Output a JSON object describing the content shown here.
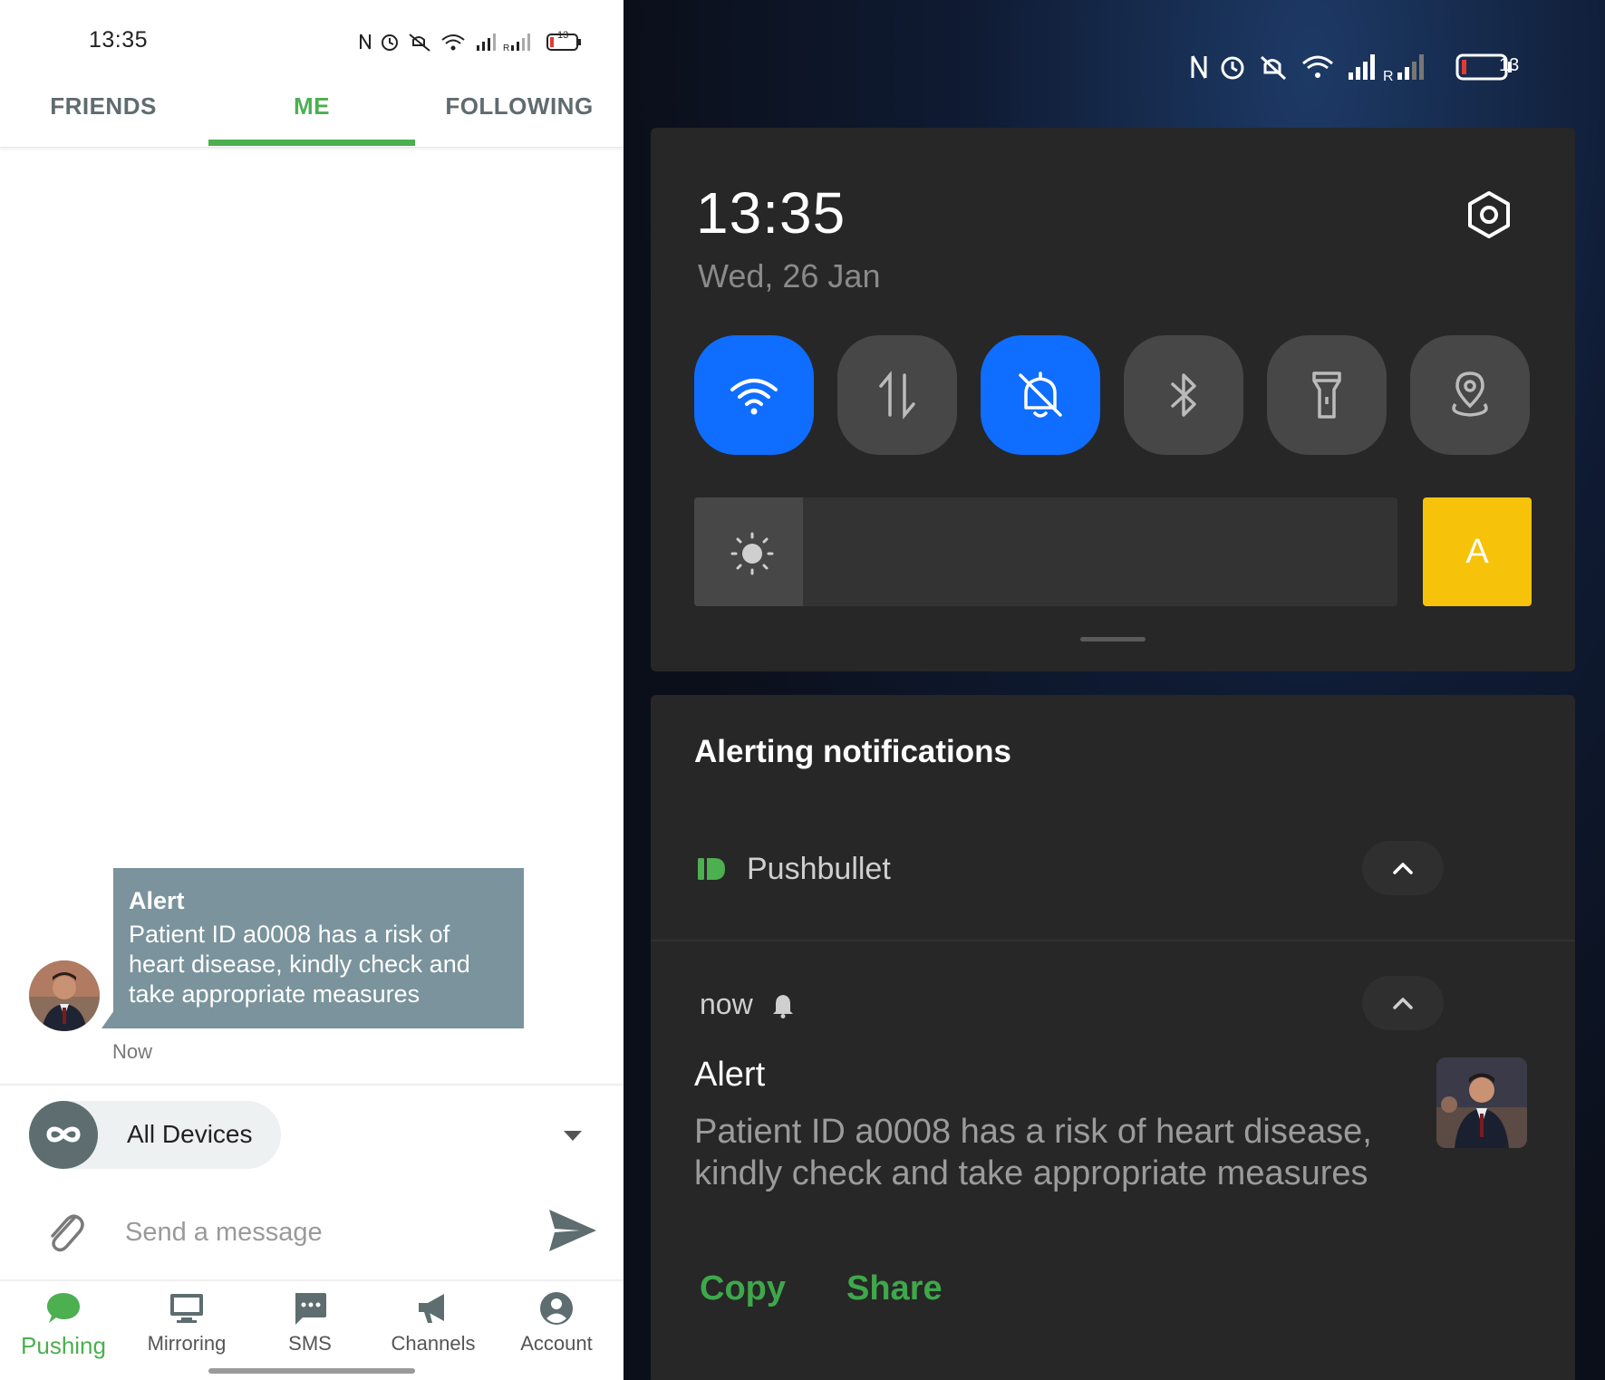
{
  "left": {
    "status_bar": {
      "time": "13:35",
      "battery": "13"
    },
    "tabs": [
      {
        "label": "FRIENDS",
        "active": false
      },
      {
        "label": "ME",
        "active": true
      },
      {
        "label": "FOLLOWING",
        "active": false
      }
    ],
    "message": {
      "title": "Alert",
      "body": "Patient ID a0008 has a risk of heart disease, kindly check and take appropriate measures",
      "time": "Now"
    },
    "device_selector": {
      "label": "All Devices"
    },
    "composer": {
      "placeholder": "Send a message"
    },
    "bottom_nav": [
      {
        "label": "Pushing",
        "icon": "chat-bubble-icon",
        "active": true
      },
      {
        "label": "Mirroring",
        "icon": "monitor-icon",
        "active": false
      },
      {
        "label": "SMS",
        "icon": "sms-icon",
        "active": false
      },
      {
        "label": "Channels",
        "icon": "megaphone-icon",
        "active": false
      },
      {
        "label": "Account",
        "icon": "account-icon",
        "active": false
      }
    ],
    "colors": {
      "accent": "#4caf50",
      "bubble": "#7a939c"
    }
  },
  "right": {
    "status_bar": {
      "battery": "13"
    },
    "quick_settings": {
      "time": "13:35",
      "date": "Wed, 26 Jan",
      "tiles": [
        {
          "name": "wifi-icon",
          "on": true
        },
        {
          "name": "mobile-data-icon",
          "on": false
        },
        {
          "name": "silent-mode-icon",
          "on": true
        },
        {
          "name": "bluetooth-icon",
          "on": false
        },
        {
          "name": "flashlight-icon",
          "on": false
        },
        {
          "name": "location-icon",
          "on": false
        }
      ],
      "brightness_level": 0.155,
      "auto_brightness_label": "A"
    },
    "notifications": {
      "header": "Alerting notifications",
      "app_name": "Pushbullet",
      "time": "now",
      "title": "Alert",
      "body": "Patient ID a0008 has a risk of heart disease, kindly check and take appropriate measures",
      "actions": [
        "Copy",
        "Share"
      ]
    },
    "colors": {
      "tile_on": "#0f6dff",
      "auto_button": "#f7c20a",
      "action_text": "#3ea84b"
    }
  }
}
